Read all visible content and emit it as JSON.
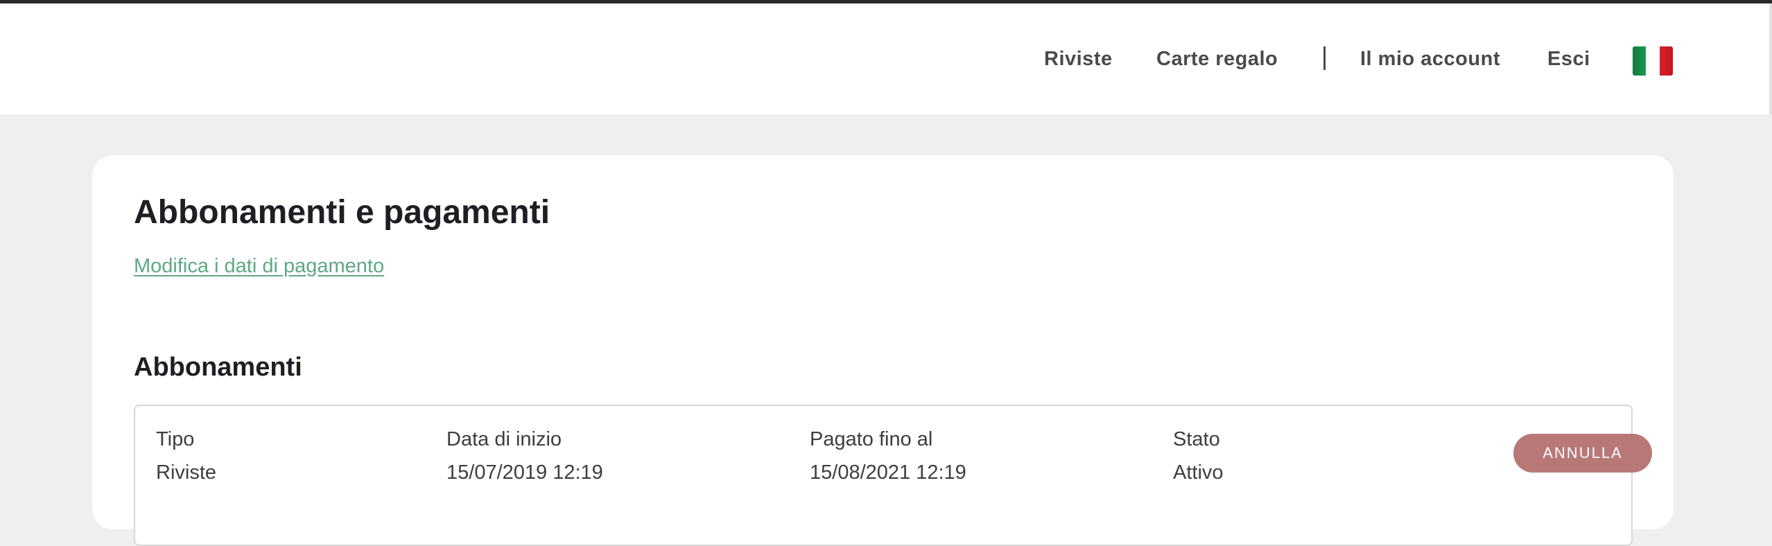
{
  "nav": {
    "items": [
      {
        "label": "Riviste"
      },
      {
        "label": "Carte regalo"
      },
      {
        "label": "Il mio account"
      },
      {
        "label": "Esci"
      }
    ],
    "language_flag": "italy-flag-icon"
  },
  "page": {
    "title": "Abbonamenti e pagamenti",
    "edit_payment_link": "Modifica i dati di pagamento",
    "subscriptions_heading": "Abbonamenti"
  },
  "subscription": {
    "columns": {
      "type": "Tipo",
      "start_date": "Data di inizio",
      "paid_until": "Pagato fino al",
      "status": "Stato"
    },
    "row": {
      "type": "Riviste",
      "start_date": "15/07/2019 12:19",
      "paid_until": "15/08/2021 12:19",
      "status": "Attivo"
    },
    "cancel_label": "ANNULLA"
  },
  "colors": {
    "accent_link": "#5fa887",
    "cancel_button": "#b97878",
    "background": "#efefef"
  }
}
